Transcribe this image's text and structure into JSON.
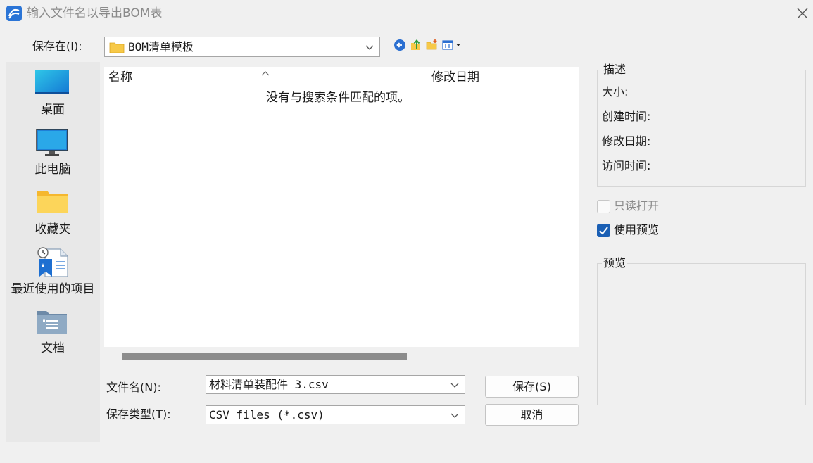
{
  "window": {
    "title": "输入文件名以导出BOM表"
  },
  "toolbar": {
    "save_in_label": "保存在(I):",
    "save_in_value": "BOM清单模板"
  },
  "places": [
    {
      "label": "桌面",
      "icon": "desktop-icon"
    },
    {
      "label": "此电脑",
      "icon": "computer-icon"
    },
    {
      "label": "收藏夹",
      "icon": "folder-icon"
    },
    {
      "label": "最近使用的项目",
      "icon": "recent-icon"
    },
    {
      "label": "文档",
      "icon": "documents-icon"
    }
  ],
  "filelist": {
    "columns": [
      "名称",
      "修改日期"
    ],
    "empty_message": "没有与搜索条件匹配的项。"
  },
  "form": {
    "filename_label": "文件名(N):",
    "filename_value": "材料清单装配件_3.csv",
    "filetype_label": "保存类型(T):",
    "filetype_value": "CSV files (*.csv)",
    "save_button": "保存(S)",
    "cancel_button": "取消"
  },
  "description": {
    "legend": "描述",
    "rows": [
      "大小:",
      "创建时间:",
      "修改日期:",
      "访问时间:"
    ]
  },
  "options": {
    "read_only_label": "只读打开",
    "read_only_checked": false,
    "preview_label": "使用预览",
    "preview_checked": true
  },
  "preview": {
    "legend": "预览"
  },
  "colors": {
    "accent": "#1a5fb4",
    "window_bg": "#f0f0f0",
    "folder": "#f7c948"
  }
}
